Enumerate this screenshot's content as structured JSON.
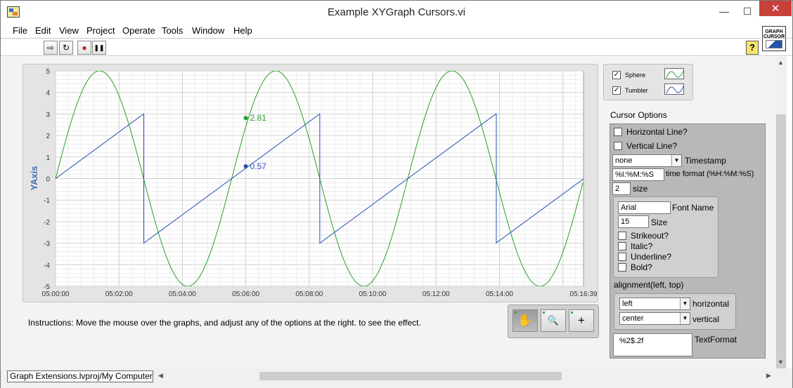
{
  "window": {
    "title": "Example XYGraph Cursors.vi",
    "min_glyph": "—",
    "max_glyph": "☐",
    "close_glyph": "✕"
  },
  "menu": [
    "File",
    "Edit",
    "View",
    "Project",
    "Operate",
    "Tools",
    "Window",
    "Help"
  ],
  "toolbar": {
    "run": "⇨",
    "run_continuous": "↻",
    "abort": "●",
    "pause": "❚❚",
    "help": "?"
  },
  "graph_cursor_icon": {
    "line1": "GRAPH",
    "line2": "CURSOR"
  },
  "graph": {
    "y_axis_label": "YAxis",
    "y_ticks": [
      "5",
      "4",
      "3",
      "2",
      "1",
      "0",
      "-1",
      "-2",
      "-3",
      "-4",
      "-5"
    ],
    "x_ticks": [
      "05:00:00",
      "05:02:00",
      "05:04:00",
      "05:06:00",
      "05:08:00",
      "05:10:00",
      "05:12:00",
      "05:14:00",
      "05:16:39"
    ],
    "cursor_labels": [
      "2.81",
      "0.57"
    ]
  },
  "chart_data": {
    "type": "line",
    "ylabel": "YAxis",
    "xlabel": "",
    "xlim": [
      "05:00:00",
      "05:16:39"
    ],
    "ylim": [
      -5,
      5
    ],
    "grid": true,
    "series": [
      {
        "name": "Sphere",
        "kind": "sine",
        "amplitude": 5,
        "period_minutes": 5.555,
        "color": "#2aa02a"
      },
      {
        "name": "Tumbler",
        "kind": "sawtooth",
        "min": -3,
        "max": 3,
        "period_minutes": 5.555,
        "color": "#2850b0"
      }
    ],
    "cursors": [
      {
        "x": "05:06:00",
        "y": 2.81,
        "series": "Sphere",
        "label": "2.81",
        "color": "#2aa02a"
      },
      {
        "x": "05:06:00",
        "y": 0.57,
        "series": "Tumbler",
        "label": "0.57",
        "color": "#2850b0"
      }
    ]
  },
  "legend": [
    {
      "name": "Sphere",
      "checked": true,
      "check_glyph": "✓",
      "color": "#2aa02a"
    },
    {
      "name": "Tumbler",
      "checked": true,
      "check_glyph": "✓",
      "color": "#2850b0"
    }
  ],
  "instructions": "Instructions: Move the mouse over the graphs, and adjust any of the options at the right. to see the effect.",
  "palette": {
    "hand": "✋",
    "zoom": "🔍",
    "cursor": "+"
  },
  "cursor_options": {
    "label": "Cursor Options",
    "horizontal_line": "Horizontal Line?",
    "vertical_line": "Vertical Line?",
    "timestamp_value": "none",
    "timestamp_label": "Timestamp",
    "time_format_value": "%I:%M:%S",
    "time_format_label": "time format (%H:%M:%S)",
    "size_value": "2",
    "size_label": "size",
    "font_name_value": "Arial",
    "font_name_label": "Font Name",
    "font_size_value": "15",
    "font_size_label": "Size",
    "strikeout": "Strikeout?",
    "italic": "Italic?",
    "underline": "Underline?",
    "bold": "Bold?",
    "alignment_label": "alignment(left, top)",
    "horizontal_value": "left",
    "horizontal_label": "horizontal",
    "vertical_value": "center",
    "vertical_label": "vertical",
    "text_format_value": "%2$.2f",
    "text_format_label": "TextFormat",
    "drop_glyph": "▼"
  },
  "status": {
    "project": "Graph Extensions.lvproj/My Computer"
  },
  "scroll_arrows": {
    "up": "▲",
    "down": "▼",
    "left": "◀",
    "right": "▶"
  }
}
